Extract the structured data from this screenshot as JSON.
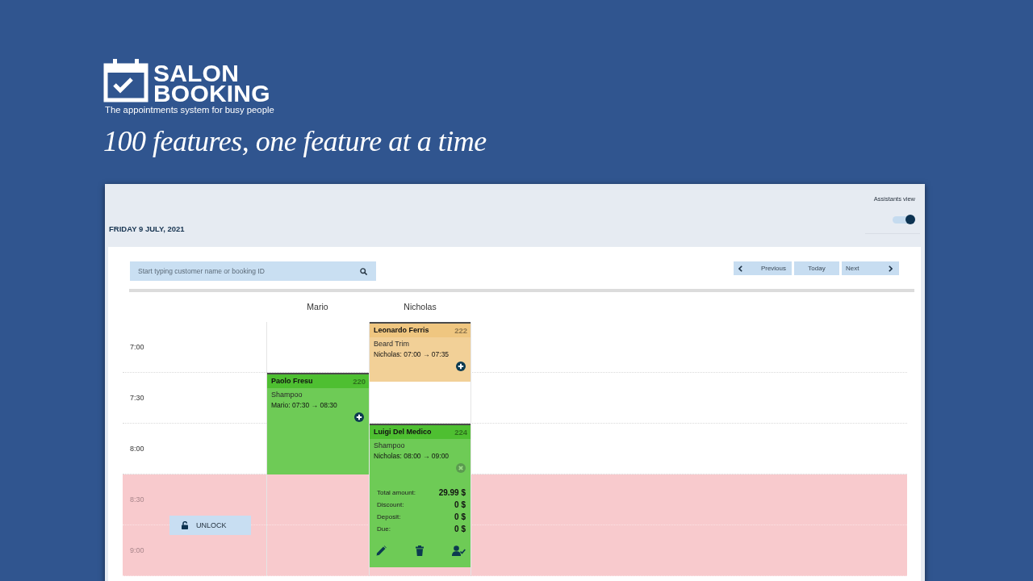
{
  "brand": {
    "name_lines": [
      "SALON",
      "BOOKING"
    ],
    "tagline": "The appointments system for busy people"
  },
  "headline": "100 features, one feature at a time",
  "window": {
    "date": "FRIDAY 9 JULY, 2021",
    "assistants_view": {
      "label": "Assistants view",
      "on": true
    },
    "search": {
      "placeholder": "Start typing customer name or booking ID"
    },
    "nav_buttons": [
      {
        "kind": "previous",
        "label": "Previous"
      },
      {
        "kind": "today",
        "label": "Today"
      },
      {
        "kind": "next",
        "label": "Next"
      }
    ],
    "calendar": {
      "assistants": [
        {
          "name": "Mario",
          "bookings": [
            {
              "customer": "Paolo Fresu",
              "id": "220",
              "service": "Shampoo",
              "time": "Mario: 07:30 → 08:30",
              "color": "#4ebf31",
              "expanded": false
            }
          ]
        },
        {
          "name": "Nicholas",
          "bookings": [
            {
              "customer": "Leonardo Ferris",
              "id": "222",
              "service": "Beard Trim",
              "time": "Nicholas: 07:00 → 07:35",
              "color": "#efc680",
              "expanded": false
            },
            {
              "customer": "Luigi Del Medico",
              "id": "224",
              "service": "Shampoo",
              "time": "Nicholas: 08:00 → 09:00",
              "color": "#4ebf31",
              "expanded": true,
              "totals": [
                {
                  "label": "Total amount:",
                  "value": "29.99 $"
                },
                {
                  "label": "Discount:",
                  "value": "0 $"
                },
                {
                  "label": "Deposit:",
                  "value": "0 $"
                },
                {
                  "label": "Due:",
                  "value": "0 $"
                }
              ]
            }
          ]
        }
      ],
      "time_rows": [
        {
          "label": "7:00",
          "blocked": false
        },
        {
          "label": "7:30",
          "blocked": false
        },
        {
          "label": "8:00",
          "blocked": false
        },
        {
          "label": "8:30",
          "blocked": true
        },
        {
          "label": "9:00",
          "blocked": true
        }
      ],
      "unlock_button": "UNLOCK"
    }
  }
}
